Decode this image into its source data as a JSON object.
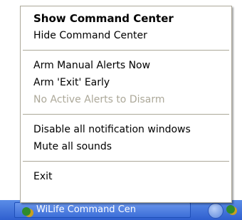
{
  "menu": {
    "items": [
      {
        "label": "Show Command Center"
      },
      {
        "label": "Hide Command Center"
      },
      {
        "label": "Arm Manual Alerts Now"
      },
      {
        "label": "Arm 'Exit' Early"
      },
      {
        "label": "No Active Alerts to Disarm"
      },
      {
        "label": "Disable all notification windows"
      },
      {
        "label": "Mute all sounds"
      },
      {
        "label": "Exit"
      }
    ]
  },
  "taskbar": {
    "task_label": "WiLife Command Cen"
  }
}
